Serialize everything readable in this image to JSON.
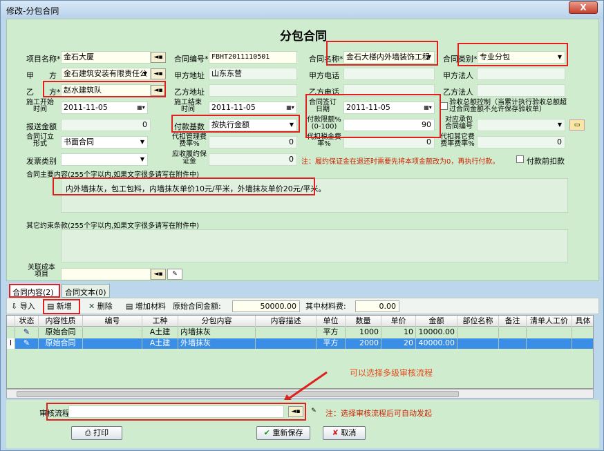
{
  "window": {
    "title": "修改-分包合同",
    "close": "X"
  },
  "form": {
    "title": "分包合同",
    "project_name_label": "项目名称*",
    "project_name": "金石大厦",
    "contract_no_label": "合同编号*",
    "contract_no": "FBHT2011110501",
    "contract_name_label": "合同名称*",
    "contract_name": "金石大楼内外墙装饰工程",
    "contract_type_label": "合同类别*",
    "contract_type": "专业分包",
    "party_a_label": "甲　　方",
    "party_a": "金石建筑安装有限责任公",
    "party_a_addr_label": "甲方地址",
    "party_a_addr": "山东东营",
    "party_a_tel_label": "甲方电话",
    "party_a_legal_label": "甲方法人",
    "party_b_label": "乙　　方*",
    "party_b": "赵水建筑队",
    "party_b_addr_label": "乙方地址",
    "party_b_tel_label": "乙方电话",
    "party_b_legal_label": "乙方法人",
    "start_label": "施工开始时间",
    "start": "2011-11-05",
    "end_label": "施工结束时间",
    "end": "2011-11-05",
    "sign_label": "合同签订日期",
    "sign": "2011-11-05",
    "acceptance_label": "验收总额控制（当累计执行验收总额超过合同金额不允许保存验收单）",
    "report_amount_label": "报送金额",
    "report_amount": "0",
    "pay_base_label": "付款基数",
    "pay_base": "按执行金额",
    "pay_limit_label": "付款限额%(0-100)",
    "pay_limit": "90",
    "sub_no_label": "对应承包合同编号",
    "sign_form_label": "合同订立形式",
    "sign_form": "书面合同",
    "mgmt_fee_label": "代扣管理费费率%",
    "mgmt_fee": "0",
    "tax_label": "代扣税金费率%",
    "tax": "0",
    "other_fee_label": "代扣其它费费率费率%",
    "other_fee": "0",
    "invoice_label": "发票类别",
    "bond_label": "应收履约保证金",
    "bond": "0",
    "bond_note": "注：履约保证金在退还时需要先将本项金额改为0，再执行付款。",
    "prepay_label": "付款前扣款",
    "content_label": "合同主要内容(255个字以内,如果文字很多请写在附件中)",
    "content": "内外墙抹灰，包工包料，内墙抹灰单价10元/平米，外墙抹灰单价20元/平米。",
    "other_label": "其它约束条款(255个字以内,如果文字很多请写在附件中)",
    "cost_label": "关联成本项目"
  },
  "tabs": [
    "合同内容(2)",
    "合同文本(0)"
  ],
  "toolbar": {
    "import": "导入",
    "add": "新增",
    "delete": "删除",
    "add_material": "增加材料",
    "orig_amount_label": "原始合同金额:",
    "orig_amount": "50000.00",
    "material_fee_label": "其中材料费:",
    "material_fee": "0.00"
  },
  "grid": {
    "headers": [
      "状态",
      "内容性质",
      "编号",
      "工种",
      "分包内容",
      "内容描述",
      "单位",
      "数量",
      "单价",
      "金额",
      "部位名称",
      "备注",
      "清单人工价",
      "具体"
    ],
    "rows": [
      {
        "nature": "原始合同",
        "code": "",
        "work": "A土建",
        "content": "内墙抹灰",
        "desc": "",
        "unit": "平方",
        "qty": "1000",
        "price": "10",
        "amount": "10000.00"
      },
      {
        "nature": "原始合同",
        "code": "",
        "work": "A土建",
        "content": "外墙抹灰",
        "desc": "",
        "unit": "平方",
        "qty": "2000",
        "price": "20",
        "amount": "40000.00"
      }
    ]
  },
  "annotation": "可以选择多级审核流程",
  "workflow": {
    "label": "审核流程",
    "note": "注：选择审核流程后可自动发起"
  },
  "buttons": {
    "print": "打印",
    "save": "重新保存",
    "cancel": "取消"
  },
  "colors": {
    "highlight": "#e02020",
    "form_bg": "#cfeccf",
    "selected_row": "#3a8ee6"
  }
}
